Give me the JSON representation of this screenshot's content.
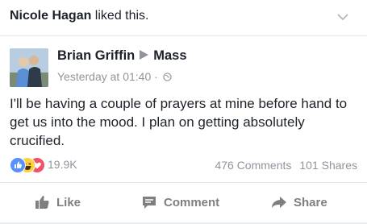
{
  "header": {
    "liker_name": "Nicole Hagan",
    "liked_text": " liked this."
  },
  "post": {
    "author": "Brian Griffin",
    "target": "Mass",
    "timestamp": "Yesterday at 01:40",
    "separator": "·",
    "privacy_icon": "globe-icon",
    "text": "I'll be having a couple of prayers at mine before hand to get us into the mood. I plan on getting absolutely crucified.",
    "reaction_icons": [
      "like-reaction-icon",
      "haha-reaction-icon",
      "love-reaction-icon"
    ],
    "reaction_count": "19.9K",
    "comments": "476 Comments",
    "shares": "101 Shares"
  },
  "actions": {
    "like": "Like",
    "comment": "Comment",
    "share": "Share"
  },
  "colors": {
    "like_blue": "#5890ff",
    "haha_yellow": "#ffcf3d",
    "love_red": "#f25268",
    "muted": "#90949c"
  }
}
